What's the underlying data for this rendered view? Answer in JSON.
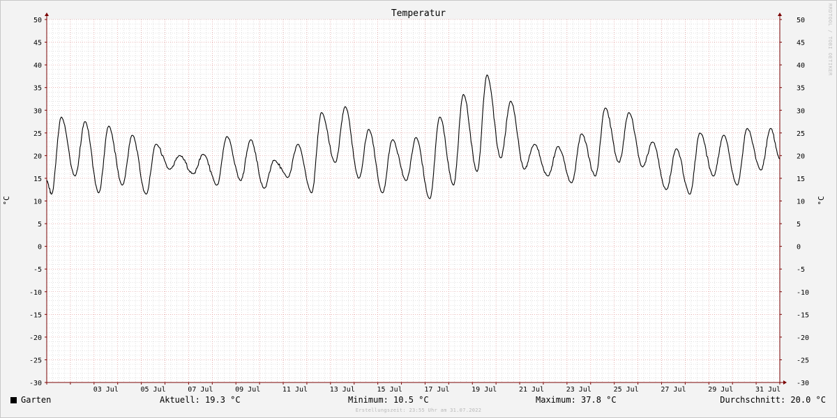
{
  "chart_data": {
    "type": "line",
    "title": "Temperatur",
    "ylabel": "°C",
    "ylabel_right": "°C",
    "ylim": [
      -30,
      50
    ],
    "ytick_step": 5,
    "yticks": [
      "50",
      "45",
      "40",
      "35",
      "30",
      "25",
      "20",
      "15",
      "10",
      "5",
      "0",
      "-5",
      "-10",
      "-15",
      "-20",
      "-25",
      "-30"
    ],
    "xlim_day": [
      1.0,
      32.0
    ],
    "xlim_label": [
      "01 Jul",
      "31 Jul 23:55"
    ],
    "xticks": [
      {
        "label": "03 Jul",
        "day": 3
      },
      {
        "label": "05 Jul",
        "day": 5
      },
      {
        "label": "07 Jul",
        "day": 7
      },
      {
        "label": "09 Jul",
        "day": 9
      },
      {
        "label": "11 Jul",
        "day": 11
      },
      {
        "label": "13 Jul",
        "day": 13
      },
      {
        "label": "15 Jul",
        "day": 15
      },
      {
        "label": "17 Jul",
        "day": 17
      },
      {
        "label": "19 Jul",
        "day": 19
      },
      {
        "label": "21 Jul",
        "day": 21
      },
      {
        "label": "23 Jul",
        "day": 23
      },
      {
        "label": "25 Jul",
        "day": 25
      },
      {
        "label": "27 Jul",
        "day": 27
      },
      {
        "label": "29 Jul",
        "day": 29
      },
      {
        "label": "31 Jul",
        "day": 31
      }
    ],
    "grid": true,
    "series": [
      {
        "name": "Garten",
        "color": "#000000",
        "daily_extremes": [
          {
            "day": 1,
            "min": 11.5,
            "max": 28.5
          },
          {
            "day": 2,
            "min": 15.5,
            "max": 27.5
          },
          {
            "day": 3,
            "min": 11.8,
            "max": 26.5
          },
          {
            "day": 4,
            "min": 13.5,
            "max": 24.5
          },
          {
            "day": 5,
            "min": 11.5,
            "max": 22.5
          },
          {
            "day": 6,
            "min": 17.0,
            "max": 20.0
          },
          {
            "day": 7,
            "min": 16.0,
            "max": 20.3
          },
          {
            "day": 8,
            "min": 13.5,
            "max": 24.2
          },
          {
            "day": 9,
            "min": 14.5,
            "max": 23.5
          },
          {
            "day": 10,
            "min": 12.8,
            "max": 19.0
          },
          {
            "day": 11,
            "min": 15.2,
            "max": 22.5
          },
          {
            "day": 12,
            "min": 11.8,
            "max": 29.5
          },
          {
            "day": 13,
            "min": 18.5,
            "max": 30.8
          },
          {
            "day": 14,
            "min": 15.0,
            "max": 25.8
          },
          {
            "day": 15,
            "min": 11.8,
            "max": 23.5
          },
          {
            "day": 16,
            "min": 14.5,
            "max": 24.0
          },
          {
            "day": 17,
            "min": 10.5,
            "max": 28.5
          },
          {
            "day": 18,
            "min": 13.5,
            "max": 33.5
          },
          {
            "day": 19,
            "min": 16.5,
            "max": 37.8
          },
          {
            "day": 20,
            "min": 19.5,
            "max": 32.0
          },
          {
            "day": 21,
            "min": 17.0,
            "max": 22.5
          },
          {
            "day": 22,
            "min": 15.5,
            "max": 22.0
          },
          {
            "day": 23,
            "min": 14.0,
            "max": 24.8
          },
          {
            "day": 24,
            "min": 15.5,
            "max": 30.5
          },
          {
            "day": 25,
            "min": 18.5,
            "max": 29.5
          },
          {
            "day": 26,
            "min": 17.5,
            "max": 23.0
          },
          {
            "day": 27,
            "min": 12.5,
            "max": 21.5
          },
          {
            "day": 28,
            "min": 11.5,
            "max": 25.0
          },
          {
            "day": 29,
            "min": 15.5,
            "max": 24.5
          },
          {
            "day": 30,
            "min": 13.5,
            "max": 26.0
          },
          {
            "day": 31,
            "min": 16.8,
            "max": 26.0
          }
        ],
        "last_value": 19.3
      }
    ],
    "legend": {
      "series_name": "Garten",
      "current": "Aktuell: 19.3 °C",
      "minimum": "Minimum: 10.5 °C",
      "maximum": "Maximum: 37.8 °C",
      "average": "Durchschnitt: 20.0 °C"
    }
  },
  "footer": "Erstellungszeit: 23:55 Uhr am 31.07.2022",
  "watermark": "RRDTOOL / TOBI OETIKER",
  "colors": {
    "background": "#f3f3f3",
    "plot_background": "#ffffff",
    "major_grid": "#e08a8a",
    "minor_grid": "#c4c4c4",
    "axis": "#7a0000",
    "line": "#000000"
  }
}
